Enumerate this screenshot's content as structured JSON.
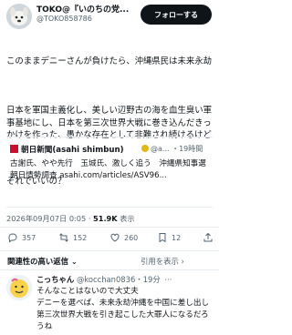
{
  "author": {
    "name": "TOKO@『いのちの党...",
    "handle": "@TOKO858786"
  },
  "follow_label": "フォローする",
  "tweet": {
    "paragraphs": [
      "このままデニーさんが負けたら、沖縄県民は未来永劫",
      "日本を軍国主義化し、美しい辺野古の海を血生臭い軍事基地にし、日本を第三次世界大戦に巻き込んだきっかけを作った、愚かな存在として非難され続けるけど",
      "それでいいの？"
    ]
  },
  "quoted": {
    "source": "朝日新聞(asahi shimbun)",
    "sub": "@a... ・19時間",
    "text": "古謝氏、やや先行　玉城氏、激しく追う　沖縄県知事選　朝日情勢調査 asahi.com/articles/ASV96..."
  },
  "meta": {
    "datetime": "2026年09月07日 0:05",
    "views": "51.9K",
    "views_label": "表示"
  },
  "actions": {
    "replies": "357",
    "reposts": "152",
    "likes": "260",
    "bookmarks": "12"
  },
  "sort": {
    "left": "関連性の高い返信",
    "right": "引用を表示"
  },
  "reply": {
    "name": "こっちゃん",
    "handle_time": "@kocchan0836・19分",
    "text": "そんなことはないので大丈夫\nデニーを選べば、未来永劫沖縄を中国に差し出し第三次世界大戦を引き起こした大罪人になるだろうね"
  },
  "colors": {
    "follow_bg": "#0f1419",
    "muted": "#536471",
    "asahi_red": "#c8102e"
  }
}
